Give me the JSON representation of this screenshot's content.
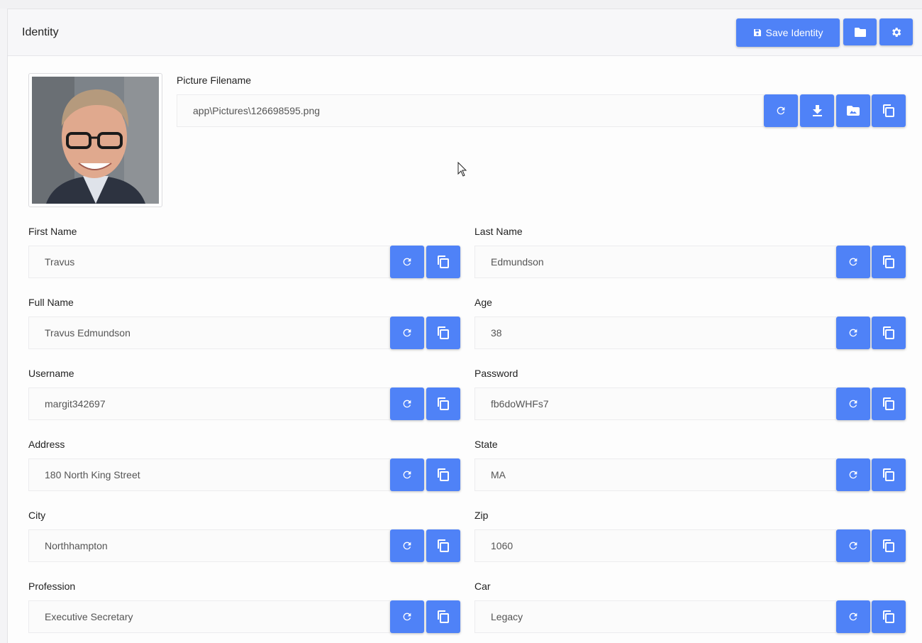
{
  "header": {
    "title": "Identity",
    "save_label": "Save Identity"
  },
  "picture": {
    "label": "Picture Filename",
    "value": "app\\Pictures\\126698595.png"
  },
  "fields": {
    "first_name": {
      "label": "First Name",
      "value": "Travus"
    },
    "last_name": {
      "label": "Last Name",
      "value": "Edmundson"
    },
    "full_name": {
      "label": "Full Name",
      "value": "Travus Edmundson"
    },
    "age": {
      "label": "Age",
      "value": "38"
    },
    "username": {
      "label": "Username",
      "value": "margit342697"
    },
    "password": {
      "label": "Password",
      "value": "fb6doWHFs7"
    },
    "address": {
      "label": "Address",
      "value": "180 North King Street"
    },
    "state": {
      "label": "State",
      "value": "MA"
    },
    "city": {
      "label": "City",
      "value": "Northhampton"
    },
    "zip": {
      "label": "Zip",
      "value": "1060"
    },
    "profession": {
      "label": "Profession",
      "value": "Executive Secretary"
    },
    "car": {
      "label": "Car",
      "value": "Legacy"
    }
  },
  "colors": {
    "accent": "#4f82f7",
    "background": "#fdfdfd",
    "header": "#f7f7f9"
  },
  "icons": [
    "save-icon",
    "folder-icon",
    "gear-icon",
    "refresh-icon",
    "download-icon",
    "image-icon",
    "copy-icon"
  ]
}
